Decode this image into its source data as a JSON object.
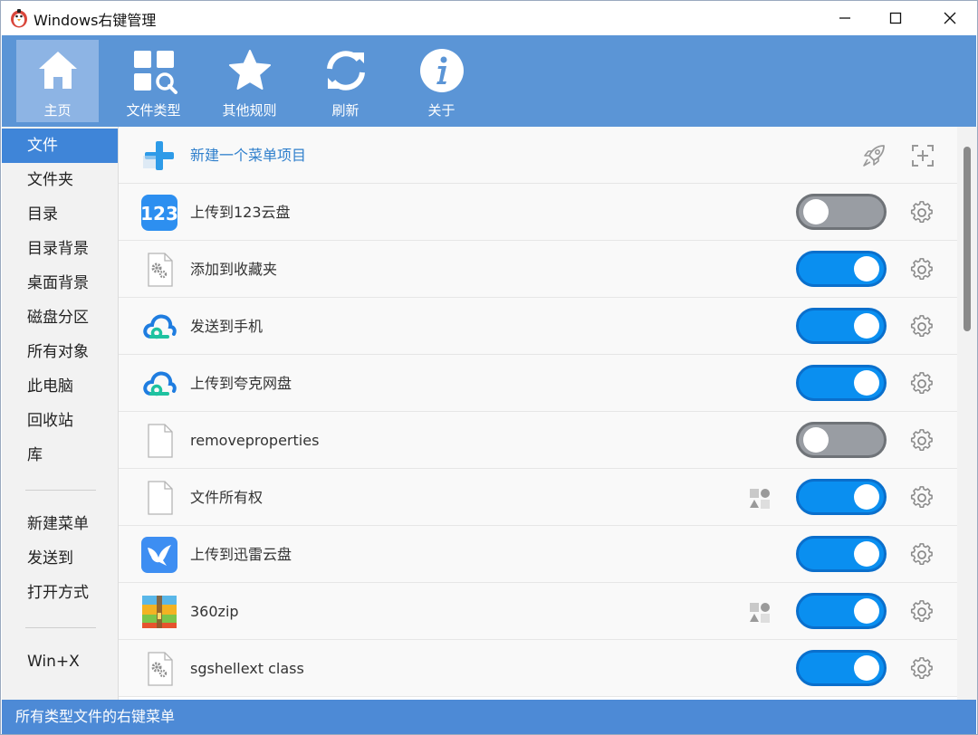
{
  "window": {
    "title": "Windows右键管理"
  },
  "toolbar": {
    "items": [
      {
        "label": "主页",
        "icon": "home-icon"
      },
      {
        "label": "文件类型",
        "icon": "file-types-icon"
      },
      {
        "label": "其他规则",
        "icon": "star-icon"
      },
      {
        "label": "刷新",
        "icon": "refresh-icon"
      },
      {
        "label": "关于",
        "icon": "info-icon"
      }
    ],
    "active_index": 0
  },
  "sidebar": {
    "groups": [
      [
        "文件",
        "文件夹",
        "目录",
        "目录背景",
        "桌面背景",
        "磁盘分区",
        "所有对象",
        "此电脑",
        "回收站",
        "库"
      ],
      [
        "新建菜单",
        "发送到",
        "打开方式"
      ],
      [
        "Win+X"
      ]
    ],
    "active": "文件"
  },
  "list": {
    "new_item_label": "新建一个菜单项目",
    "rows": [
      {
        "label": "上传到123云盘",
        "icon": "123pan-icon",
        "enabled": false,
        "shared": false
      },
      {
        "label": "添加到收藏夹",
        "icon": "gear-file-icon",
        "enabled": true,
        "shared": false
      },
      {
        "label": "发送到手机",
        "icon": "cloud-icon",
        "enabled": true,
        "shared": false
      },
      {
        "label": "上传到夸克网盘",
        "icon": "cloud-icon",
        "enabled": true,
        "shared": false
      },
      {
        "label": "removeproperties",
        "icon": "blank-file-icon",
        "enabled": false,
        "shared": false
      },
      {
        "label": "文件所有权",
        "icon": "blank-file-icon",
        "enabled": true,
        "shared": true
      },
      {
        "label": "上传到迅雷云盘",
        "icon": "thunder-bird-icon",
        "enabled": true,
        "shared": false
      },
      {
        "label": "360zip",
        "icon": "360zip-icon",
        "enabled": true,
        "shared": true
      },
      {
        "label": "sgshellext class",
        "icon": "gear-file-icon",
        "enabled": true,
        "shared": false
      }
    ]
  },
  "status": {
    "text": "所有类型文件的右键菜单"
  },
  "colors": {
    "toolbar": "#5b95d6",
    "active_tab": "#8db4e4",
    "sidebar_active": "#3f85d8",
    "toggle_on": "#0a8ff0",
    "toggle_off": "#999da3",
    "status_bar": "#4d8ad6"
  }
}
